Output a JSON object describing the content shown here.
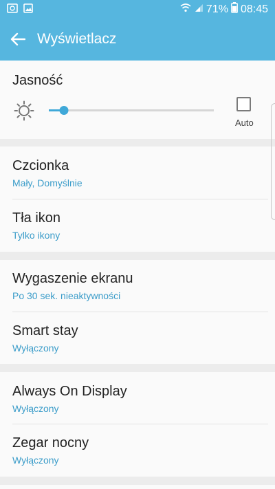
{
  "statusbar": {
    "icons_left": [
      "image-icon",
      "picture-icon"
    ],
    "battery_percent": "71%",
    "time": "08:45"
  },
  "appbar": {
    "title": "Wyświetlacz"
  },
  "brightness": {
    "label": "Jasność",
    "level": 0.09,
    "auto_label": "Auto",
    "auto_checked": false
  },
  "settings": [
    {
      "title": "Czcionka",
      "subtitle": "Mały, Domyślnie"
    },
    {
      "title": "Tła ikon",
      "subtitle": "Tylko ikony"
    },
    {
      "title": "Wygaszenie ekranu",
      "subtitle": "Po 30 sek. nieaktywności"
    },
    {
      "title": "Smart stay",
      "subtitle": "Wyłączony"
    },
    {
      "title": "Always On Display",
      "subtitle": "Wyłączony"
    },
    {
      "title": "Zegar nocny",
      "subtitle": "Wyłączony"
    }
  ],
  "colors": {
    "accent": "#56b6df",
    "link": "#3a9cc9"
  }
}
